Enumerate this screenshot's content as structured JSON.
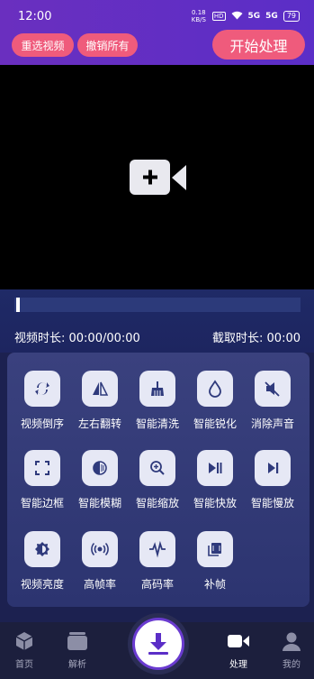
{
  "status": {
    "time": "12:00",
    "net_speed": "0.18 KB/S",
    "hd": "HD",
    "signal1": "5G",
    "signal2": "5G",
    "battery": "79"
  },
  "toolbar": {
    "reselect_label": "重选视频",
    "undo_all_label": "撤销所有",
    "start_label": "开始处理"
  },
  "info": {
    "duration_label": "视频时长: 00:00/00:00",
    "clip_label": "截取时长: 00:00"
  },
  "progress": {
    "value": 0
  },
  "tools": [
    {
      "label": "视频倒序",
      "icon": "reverse-icon"
    },
    {
      "label": "左右翻转",
      "icon": "flip-icon"
    },
    {
      "label": "智能清洗",
      "icon": "broom-icon"
    },
    {
      "label": "智能锐化",
      "icon": "drop-icon"
    },
    {
      "label": "消除声音",
      "icon": "mute-icon"
    },
    {
      "label": "智能边框",
      "icon": "frame-icon"
    },
    {
      "label": "智能模糊",
      "icon": "blur-icon"
    },
    {
      "label": "智能缩放",
      "icon": "zoom-icon"
    },
    {
      "label": "智能快放",
      "icon": "fast-forward-icon"
    },
    {
      "label": "智能慢放",
      "icon": "slow-play-icon"
    },
    {
      "label": "视频亮度",
      "icon": "brightness-icon"
    },
    {
      "label": "高帧率",
      "icon": "high-fps-icon"
    },
    {
      "label": "高码率",
      "icon": "bitrate-icon"
    },
    {
      "label": "补帧",
      "icon": "frames-icon"
    }
  ],
  "nav": [
    {
      "label": "首页",
      "icon": "home-cube-icon"
    },
    {
      "label": "解析",
      "icon": "cards-icon"
    },
    {
      "label": "处理",
      "icon": "video-camera-icon"
    },
    {
      "label": "我的",
      "icon": "person-icon"
    }
  ],
  "colors": {
    "accent_purple": "#5b2ec7",
    "pill_pink": "#ef5b7c",
    "panel": "#343b78",
    "nav_bg": "#1c1f3d"
  }
}
